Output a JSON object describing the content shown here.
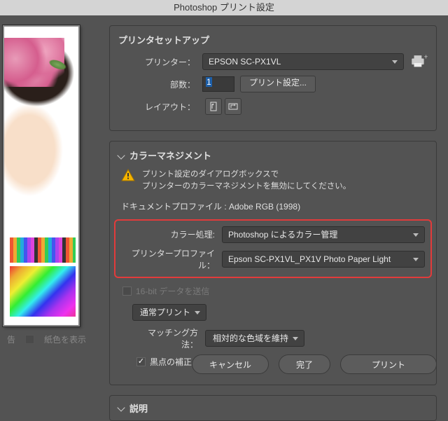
{
  "titlebar": "Photoshop プリント設定",
  "setup": {
    "heading": "プリンタセットアップ",
    "printer_label": "プリンター：",
    "printer_value": "EPSON SC-PX1VL",
    "copies_label": "部数：",
    "copies_value": "1",
    "print_settings_btn": "プリント設定...",
    "layout_label": "レイアウト："
  },
  "color": {
    "heading": "カラーマネジメント",
    "warn_line1": "プリント設定のダイアログボックスで",
    "warn_line2": "プリンターのカラーマネジメントを無効にしてください。",
    "doc_profile": "ドキュメントプロファイル : Adobe RGB (1998)",
    "handling_label": "カラー処理:",
    "handling_value": "Photoshop によるカラー管理",
    "printer_profile_label": "プリンタープロファイル：",
    "printer_profile_value": "Epson SC-PX1VL_PX1V Photo Paper Light",
    "send16_label": "16-bit データを送信",
    "print_mode_value": "通常プリント",
    "intent_label": "マッチング方法：",
    "intent_value": "相対的な色域を維持",
    "bpc_label": "黒点の補正"
  },
  "desc": {
    "heading": "説明"
  },
  "footer": {
    "gamut_label": "告",
    "paper_label": "紙色を表示",
    "cancel": "キャンセル",
    "done": "完了",
    "print": "プリント"
  }
}
